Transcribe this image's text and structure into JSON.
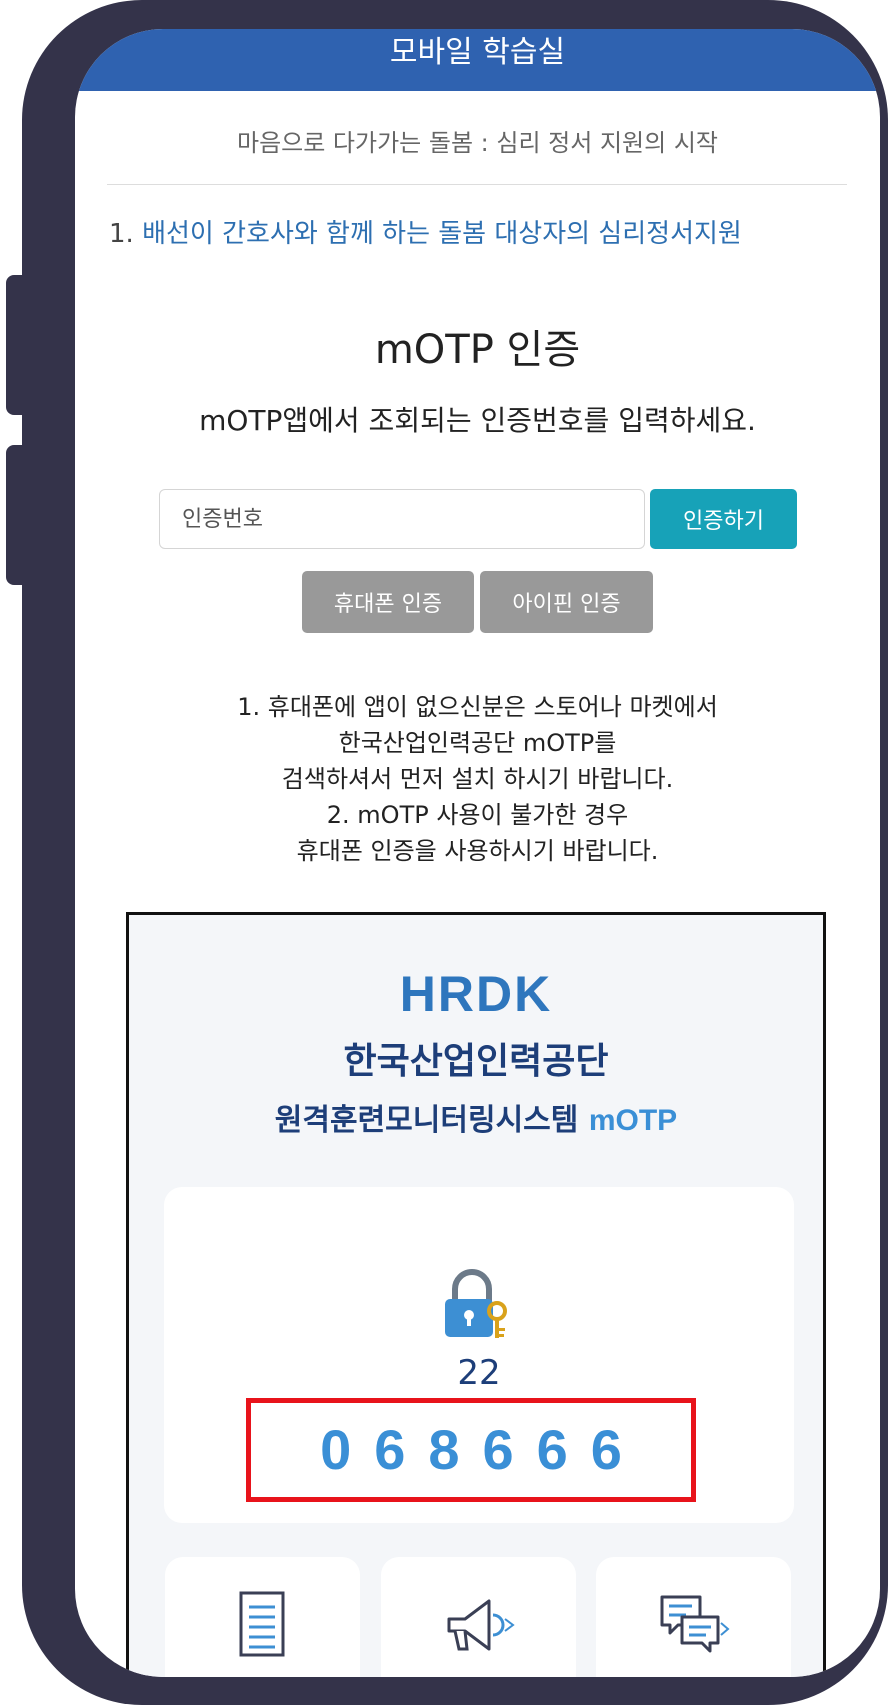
{
  "app_bar": {
    "title": "모바일 학습실"
  },
  "course": {
    "subtitle": "마음으로 다가가는 돌봄 : 심리 정서 지원의 시작",
    "chapter_number": "1.",
    "chapter_title": "배선이 간호사와 함께 하는 돌봄 대상자의 심리정서지원"
  },
  "auth": {
    "title": "mOTP 인증",
    "description": "mOTP앱에서 조회되는 인증번호를 입력하세요.",
    "input_placeholder": "인증번호",
    "verify_button": "인증하기",
    "phone_auth_button": "휴대폰 인증",
    "ipin_auth_button": "아이핀 인증"
  },
  "notice_lines": [
    "1. 휴대폰에 앱이 없으신분은 스토어나 마켓에서",
    "한국산업인력공단 mOTP를",
    "검색하셔서 먼저 설치 하시기 바랍니다.",
    "2. mOTP 사용이 불가한 경우",
    "휴대폰 인증을 사용하시기 바랍니다."
  ],
  "app_screenshot": {
    "logo": "HRDK",
    "org_name": "한국산업인력공단",
    "system_name": "원격훈련모니터링시스템",
    "system_suffix": "mOTP",
    "timer": "22",
    "otp_code": "068666",
    "icons": [
      "lock-key-icon",
      "document-icon",
      "megaphone-icon",
      "chat-bubbles-icon"
    ]
  },
  "colors": {
    "app_bar": "#2f62b0",
    "chapter_text": "#2d6fb1",
    "verify_button": "#17a2b8",
    "gray_button": "#999999",
    "otp_digits": "#3a8fd6",
    "highlight_box": "#e8131b",
    "frame": "#34334a"
  }
}
